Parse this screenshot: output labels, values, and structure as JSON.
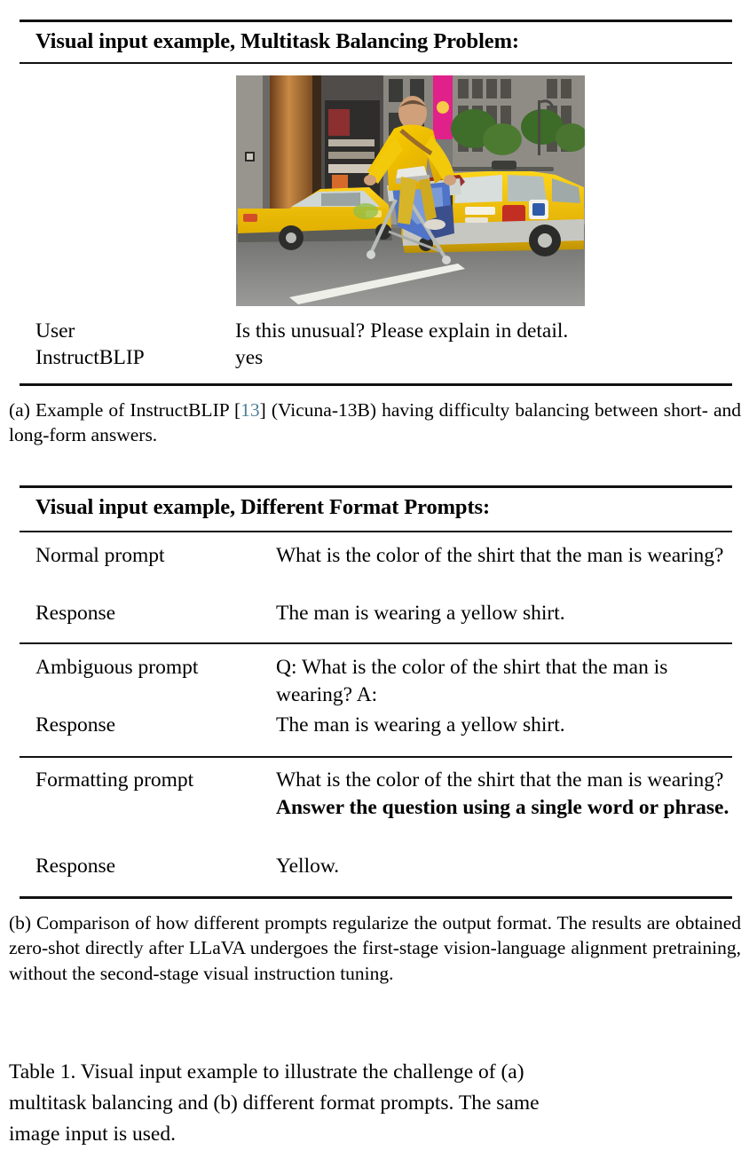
{
  "document": {
    "figure_number": "Table 1"
  },
  "table_a": {
    "title": "Visual input example, Multitask Balancing Problem:",
    "image": {
      "alt": "Photograph of a man ironing clothes on an ironing board attached to the rear of a yellow taxi SUV in a city street, with another yellow taxi passing by",
      "name": "taxi-ironing-photo"
    },
    "rows": [
      {
        "label": "User",
        "value": "Is this unusual? Please explain in detail."
      },
      {
        "label": "InstructBLIP",
        "value": "yes"
      }
    ],
    "caption_prefix": "(a) Example of InstructBLIP ",
    "caption_cite_open": "[",
    "caption_cite": "13",
    "caption_cite_close": "]",
    "caption_suffix": " (Vicuna-13B) having difficulty balancing between short- and long-form answers."
  },
  "table_b": {
    "title": "Visual input example, Different Format Prompts:",
    "groups": [
      {
        "prompt_label": "Normal prompt",
        "prompt_text": "What is the color of the shirt that the man is wearing?",
        "prompt_bold": "",
        "response_label": "Response",
        "response_text": "The man is wearing a yellow shirt."
      },
      {
        "prompt_label": "Ambiguous prompt",
        "prompt_text": "Q: What is the color of the shirt that the man is wearing? A:",
        "prompt_bold": "",
        "response_label": "Response",
        "response_text": "The man is wearing a yellow shirt."
      },
      {
        "prompt_label": "Formatting prompt",
        "prompt_text": "What is the color of the shirt that the man is wearing? ",
        "prompt_bold": "Answer the question using a single word or phrase.",
        "response_label": "Response",
        "response_text": "Yellow."
      }
    ],
    "caption": "(b) Comparison of how different prompts regularize the output format. The results are obtained zero-shot directly after LLaVA undergoes the first-stage vision-language alignment pretraining, without the second-stage visual instruction tuning."
  },
  "table_caption": {
    "line_a": "Table 1.  Visual input example to illustrate the challenge of (a)",
    "line_b": "multitask balancing and (b) different format prompts.  The same",
    "line_c": "image input is used."
  },
  "colors": {
    "text": "#000000",
    "rule": "#111111",
    "citation": "#4e7f97"
  }
}
